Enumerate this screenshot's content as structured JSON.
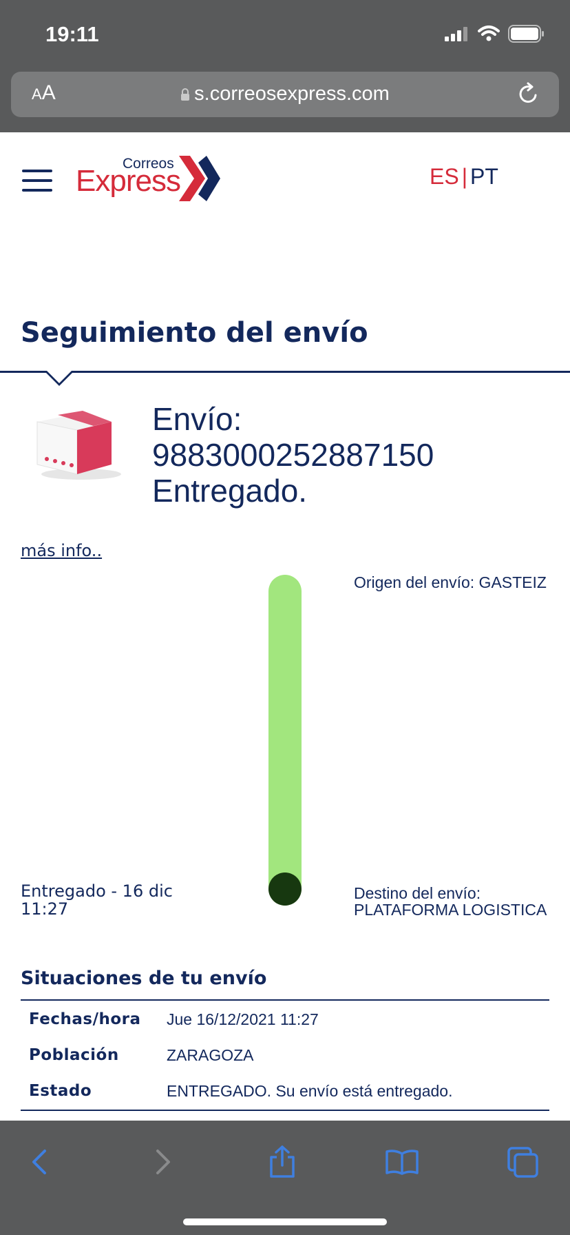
{
  "status_bar": {
    "time": "19:11",
    "icons": [
      "signal-icon",
      "wifi-icon",
      "battery-icon"
    ]
  },
  "browser": {
    "aa_small": "A",
    "aa_large": "A",
    "url": "s.correosexpress.com",
    "icons": [
      "lock-icon",
      "reload-icon"
    ]
  },
  "header": {
    "logo_correos": "Correos",
    "logo_express": "Express",
    "lang_es": "ES",
    "lang_sep": "|",
    "lang_pt": "PT"
  },
  "page": {
    "title": "Seguimiento del envío"
  },
  "shipment": {
    "label": "Envío:",
    "number": "9883000252887150",
    "status": "Entregado.",
    "more_info": "más info.."
  },
  "progress": {
    "completion": 1.0,
    "origin": "Origen del envío: GASTEIZ",
    "delivered_line1": "Entregado - 16 dic",
    "delivered_line2": "11:27",
    "destination_label": "Destino del envío:",
    "destination_value": "PLATAFORMA LOGISTICA"
  },
  "situations": {
    "title": "Situaciones de tu envío",
    "rows": [
      {
        "key": "Fechas/hora",
        "value": "Jue 16/12/2021 11:27"
      },
      {
        "key": "Población",
        "value": "ZARAGOZA"
      },
      {
        "key": "Estado",
        "value": "ENTREGADO. Su envío está entregado."
      }
    ]
  },
  "colors": {
    "brand_navy": "#13285c",
    "brand_red": "#d52b3a",
    "progress_green": "#a2e67e",
    "progress_dot": "#173810",
    "chrome_gray": "#595a5b",
    "ios_blue": "#3f7fe0"
  },
  "toolbar": {
    "icons": [
      "back-icon",
      "forward-icon",
      "share-icon",
      "bookmarks-icon",
      "tabs-icon"
    ]
  }
}
